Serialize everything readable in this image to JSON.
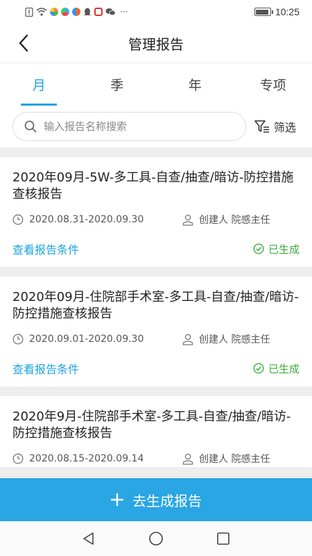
{
  "status_bar": {
    "time": "10:25",
    "icons": [
      "sim-alert-icon",
      "wifi-icon",
      "app-icon",
      "app-icon",
      "app-icon",
      "qq-icon",
      "notification-icon",
      "wechat-icon",
      "more-icon"
    ],
    "more": "···",
    "battery_level": 0.9
  },
  "header": {
    "title": "管理报告",
    "back_icon": "chevron-left-icon"
  },
  "tabs": [
    {
      "label": "月",
      "active": true
    },
    {
      "label": "季",
      "active": false
    },
    {
      "label": "年",
      "active": false
    },
    {
      "label": "专项",
      "active": false
    }
  ],
  "search": {
    "placeholder": "输入报告名称搜索",
    "value": "",
    "filter_label": "筛选"
  },
  "reports": [
    {
      "title": "2020年09月-5W-多工具-自查/抽查/暗访-防控措施查核报告",
      "date_range": "2020.08.31-2020.09.30",
      "creator": "创建人 院感主任",
      "link": "查看报告条件",
      "status": "已生成"
    },
    {
      "title": "2020年09月-住院部手术室-多工具-自查/抽查/暗访-防控措施查核报告",
      "date_range": "2020.09.01-2020.09.30",
      "creator": "创建人 院感主任",
      "link": "查看报告条件",
      "status": "已生成"
    },
    {
      "title": "2020年9月-住院部手术室-多工具-自查/抽查/暗访-防控措施查核报告",
      "date_range": "2020.08.15-2020.09.14",
      "creator": "创建人 院感主任",
      "link": "",
      "status": ""
    }
  ],
  "generate_button": {
    "label": "去生成报告"
  },
  "colors": {
    "accent": "#1ba4df",
    "button": "#29a6e3",
    "success": "#3bab3b",
    "background": "#eeeeee"
  }
}
